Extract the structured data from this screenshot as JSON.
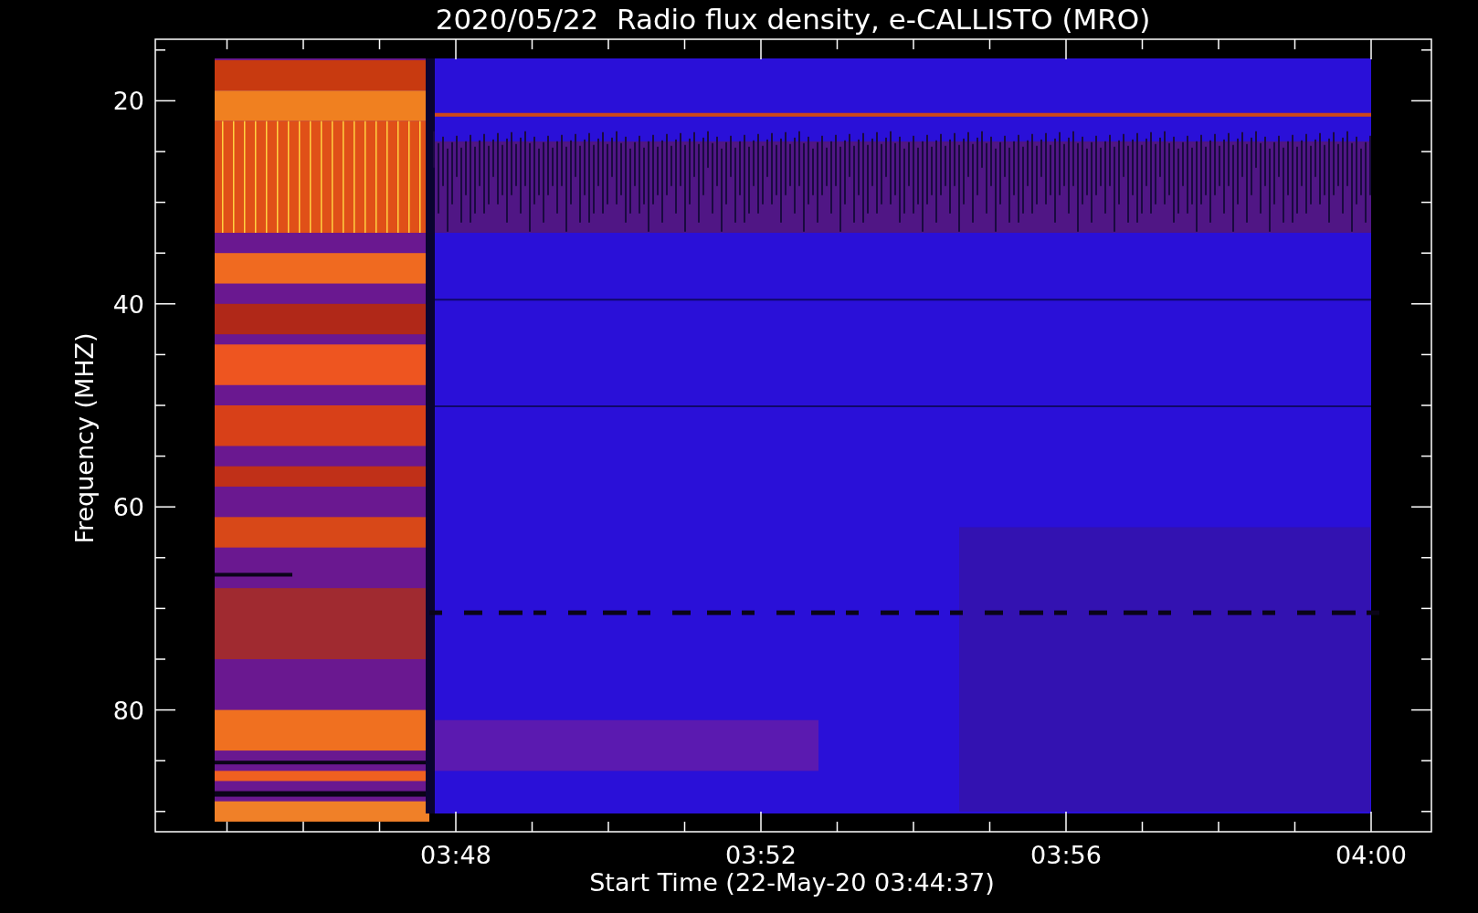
{
  "title": "2020/05/22  Radio flux density, e-CALLISTO (MRO)",
  "y_axis": {
    "label": "Frequency (MHZ)",
    "ticks": [
      "20",
      "40",
      "60",
      "80"
    ]
  },
  "x_axis": {
    "label": "Start Time (22-May-20 03:44:37)",
    "ticks": [
      "03:48",
      "03:52",
      "03:56",
      "04:00"
    ]
  }
}
